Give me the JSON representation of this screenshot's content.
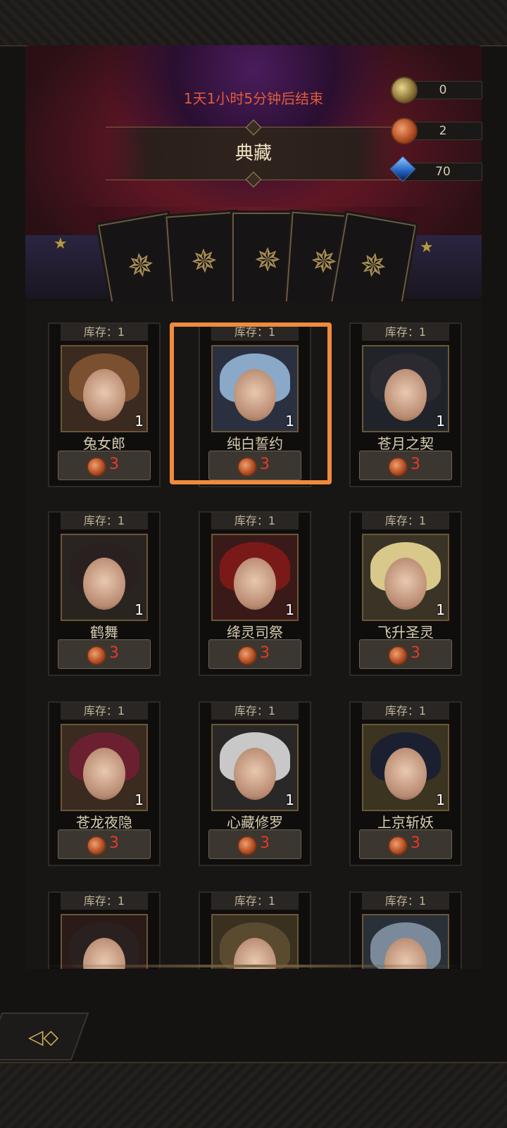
{
  "event": {
    "timer": "1天1小时5分钟后结束",
    "title": "典藏"
  },
  "currencies": [
    {
      "icon": "gold-coin-icon",
      "value": "0"
    },
    {
      "icon": "copper-coin-icon",
      "value": "2"
    },
    {
      "icon": "blue-crystal-icon",
      "value": "70"
    }
  ],
  "items": [
    {
      "stock": "库存：1",
      "name": "兔女郎",
      "qty": "1",
      "price": "3",
      "hair": "#7a5030"
    },
    {
      "stock": "库存：1",
      "name": "纯白誓约",
      "qty": "1",
      "price": "3",
      "hair": "#8aa8c8"
    },
    {
      "stock": "库存：1",
      "name": "苍月之契",
      "qty": "1",
      "price": "3",
      "hair": "#2a2a30"
    },
    {
      "stock": "库存：1",
      "name": "鹤舞",
      "qty": "1",
      "price": "3",
      "hair": "#2a2020"
    },
    {
      "stock": "库存：1",
      "name": "绛灵司祭",
      "qty": "1",
      "price": "3",
      "hair": "#7a1a18"
    },
    {
      "stock": "库存：1",
      "name": "飞升圣灵",
      "qty": "1",
      "price": "3",
      "hair": "#d8c88a"
    },
    {
      "stock": "库存：1",
      "name": "苍龙夜隐",
      "qty": "1",
      "price": "3",
      "hair": "#6a2030"
    },
    {
      "stock": "库存：1",
      "name": "心藏修罗",
      "qty": "1",
      "price": "3",
      "hair": "#c8c8c8"
    },
    {
      "stock": "库存：1",
      "name": "上京斩妖",
      "qty": "1",
      "price": "3",
      "hair": "#1a2030"
    },
    {
      "stock": "库存：1",
      "name": "",
      "qty": "",
      "price": "",
      "hair": "#2a2020"
    },
    {
      "stock": "库存：1",
      "name": "",
      "qty": "",
      "price": "",
      "hair": "#5a4a30"
    },
    {
      "stock": "库存：1",
      "name": "",
      "qty": "",
      "price": "",
      "hair": "#7a8a9a"
    }
  ],
  "colors": {
    "highlight": "#f08a3c",
    "timer": "#e25b3c",
    "price": "#e33a2a"
  }
}
